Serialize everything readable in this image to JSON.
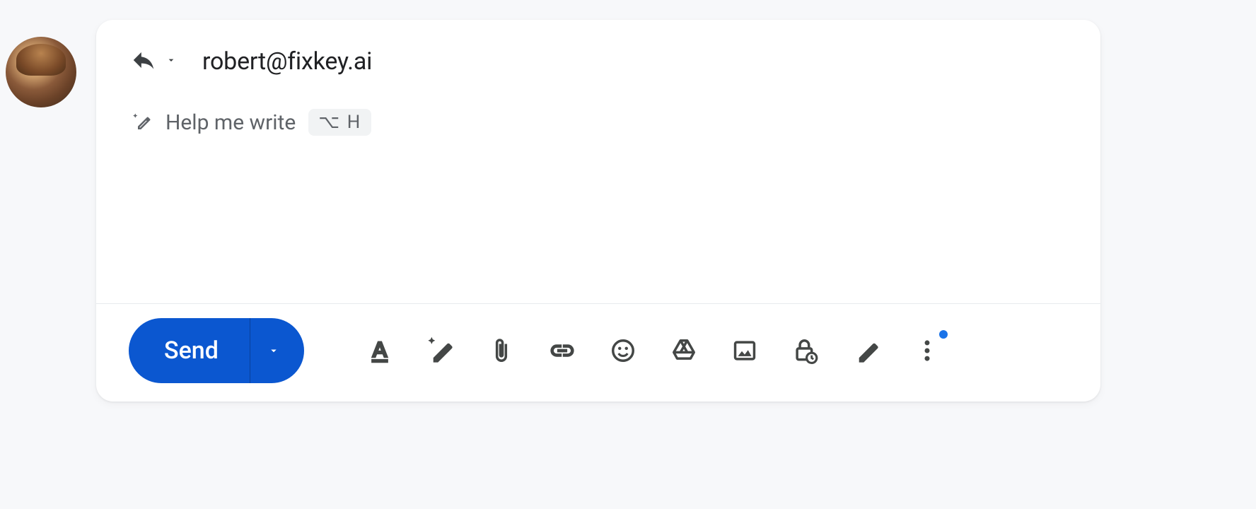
{
  "recipient": {
    "email": "robert@fixkey.ai"
  },
  "help_me_write": {
    "label": "Help me write",
    "shortcut": "⌥ H"
  },
  "toolbar": {
    "send_label": "Send",
    "icons": {
      "format": "format-text-icon",
      "ai_write": "ai-pencil-icon",
      "attach": "paperclip-icon",
      "link": "link-icon",
      "emoji": "emoji-icon",
      "drive": "drive-icon",
      "image": "image-icon",
      "confidential": "lock-clock-icon",
      "signature": "pen-icon",
      "more": "more-vert-icon"
    }
  }
}
